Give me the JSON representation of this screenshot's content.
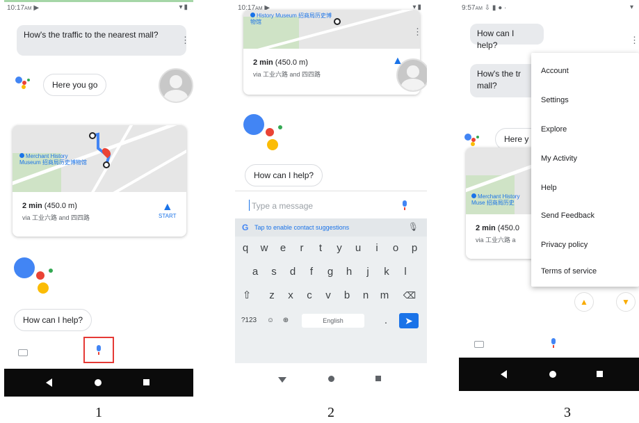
{
  "screens": [
    {
      "caption": "1",
      "status_time": "10:17",
      "status_time_suffix": "AM",
      "user_query": "How's the traffic to the nearest mall?",
      "assistant_reply": "Here you go",
      "map_poi": "Merchant History Museum 招商局历史博物馆",
      "route_time": "2 min",
      "route_distance": "(450.0 m)",
      "route_via": "via 工业六路 and 四四路",
      "start_label": "START",
      "assistant_prompt": "How can I help?"
    },
    {
      "caption": "2",
      "status_time": "10:17",
      "status_time_suffix": "AM",
      "map_poi": "History Museum 招商局历史博物馆",
      "route_time": "2 min",
      "route_distance": "(450.0 m)",
      "route_via": "via 工业六路 and 四四路",
      "assistant_prompt": "How can I help?",
      "input_placeholder": "Type a message",
      "keyboard": {
        "suggestion": "Tap to enable contact suggestions",
        "row1": [
          "q",
          "w",
          "e",
          "r",
          "t",
          "y",
          "u",
          "i",
          "o",
          "p"
        ],
        "row2": [
          "a",
          "s",
          "d",
          "f",
          "g",
          "h",
          "j",
          "k",
          "l"
        ],
        "row3": [
          "z",
          "x",
          "c",
          "v",
          "b",
          "n",
          "m"
        ],
        "symbols_key": "?123",
        "space_label": "English",
        "period_key": "."
      }
    },
    {
      "caption": "3",
      "status_time": "9:57",
      "status_time_suffix": "AM",
      "assistant_prompt_top": "How can I help?",
      "user_query_partial": "How's the tr",
      "user_query_partial_line2": "mall?",
      "assistant_reply_partial": "Here y",
      "map_poi": "Merchant History Muse 招商局历史",
      "route_time": "2 min",
      "route_distance": "(450.0",
      "route_via": "via 工业六路 a",
      "menu": [
        "Account",
        "Settings",
        "Explore",
        "My Activity",
        "Help",
        "Send Feedback",
        "Privacy policy",
        "Terms of service"
      ]
    }
  ],
  "colors": {
    "assistant_blue": "#4285f4",
    "assistant_red": "#ea4335",
    "assistant_yellow": "#fbbc05",
    "assistant_green": "#34a853",
    "highlight_red": "#e53935",
    "nav_bar": "#0b0b0b"
  }
}
